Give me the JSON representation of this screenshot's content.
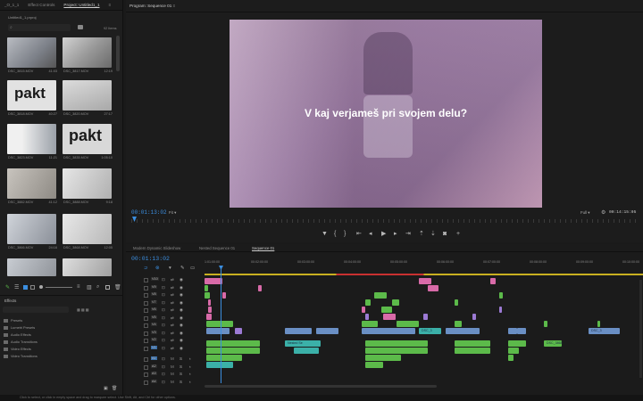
{
  "left_tabs": [
    "_O_1_1",
    "Effect Controls",
    "Project: Untitled1_1",
    "≡"
  ],
  "project": {
    "file": "Untitled1_1.prproj",
    "items_count": "92 Items",
    "search_placeholder": ""
  },
  "clips": [
    {
      "name": "DSC_3815.MOV",
      "dur": "41:03"
    },
    {
      "name": "DSC_3817.MOV",
      "dur": "12:19"
    },
    {
      "name": "DSC_3818.MOV",
      "dur": "40:27"
    },
    {
      "name": "DSC_3820.MOV",
      "dur": "27:17"
    },
    {
      "name": "DSC_3823.MOV",
      "dur": "11:21"
    },
    {
      "name": "DSC_3835.MOV",
      "dur": "1:05:10"
    },
    {
      "name": "DSC_3882.MOV",
      "dur": "41:12"
    },
    {
      "name": "DSC_3888.MOV",
      "dur": "9:18"
    },
    {
      "name": "DSC_3866.MOV",
      "dur": "24:16"
    },
    {
      "name": "DSC_3868.MOV",
      "dur": "12:05"
    }
  ],
  "effects": {
    "title": "Effects",
    "items": [
      "Presets",
      "Lumetri Presets",
      "Audio Effects",
      "Audio Transitions",
      "Video Effects",
      "Video Transitions"
    ]
  },
  "program": {
    "title": "Program: Sequence 01",
    "caption": "V kaj verjameš pri svojem delu?",
    "timecode": "00:01:13:02",
    "fit": "Fit",
    "quality": "Full",
    "duration": "00:14:15:05"
  },
  "timeline": {
    "tabs": [
      "Modern Dynamic Slideshow",
      "Nested Sequence 01",
      "Sequence 01"
    ],
    "timecode": "00:01:13:02",
    "ruler": [
      "1:01:00:00",
      "00:02:00:00",
      "00:03:00:00",
      "00:04:00:00",
      "00:05:00:00",
      "00:06:00:00",
      "00:07:00:00",
      "00:08:00:00",
      "00:09:00:00",
      "00:10:00:00"
    ],
    "tracks": [
      "V10",
      "V9",
      "V8",
      "V7",
      "V6",
      "V5",
      "V4",
      "V3",
      "V2",
      "V1",
      "A1",
      "A2",
      "A3",
      "A4"
    ],
    "clip_labels": [
      "DSC_3",
      "DSC_3",
      "Nested Se",
      "DSC_3868"
    ]
  },
  "status": "Click to select, or click in empty space and drag to marquee select. Use Shift, Alt, and Ctrl for other options.",
  "colors": {
    "accent": "#3b8ee0",
    "pink": "#d86aa8",
    "green": "#5cba4a",
    "blue": "#6a8fc4",
    "purple": "#9c7ad4",
    "teal": "#3bb0a8"
  }
}
